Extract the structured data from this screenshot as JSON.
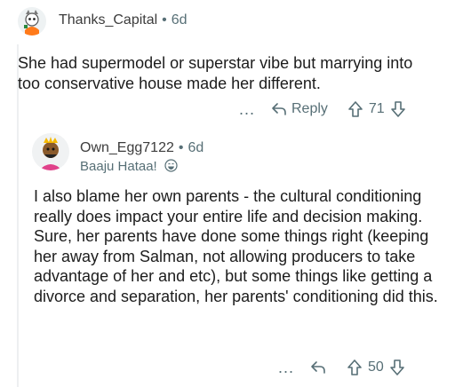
{
  "comments": [
    {
      "username": "Thanks_Capital",
      "separator": "•",
      "age": "6d",
      "body": "She had supermodel or superstar vibe but marrying into too conservative house made her different.",
      "actions": {
        "more": "...",
        "reply_label": "Reply",
        "score": "71"
      }
    },
    {
      "username": "Own_Egg7122",
      "separator": "•",
      "age": "6d",
      "flair": "Baaju Hataa!",
      "body": "I also blame her own parents - the cultural conditioning really does impact your entire life and decision making. Sure, her parents have done some things right  (keeping her away from Salman, not allowing producers to take advantage of her and etc), but some things like getting a divorce and separation, her parents' conditioning did this.",
      "actions": {
        "more": "...",
        "score": "50"
      }
    }
  ],
  "icons": {
    "reply": "reply-arrow-icon",
    "upvote": "upvote-arrow-icon",
    "downvote": "downvote-arrow-icon",
    "flair_emoji": "laughing-face-icon"
  },
  "colors": {
    "meta": "#576f76",
    "text": "#1c1c1c",
    "thread_line": "#edeff1"
  }
}
